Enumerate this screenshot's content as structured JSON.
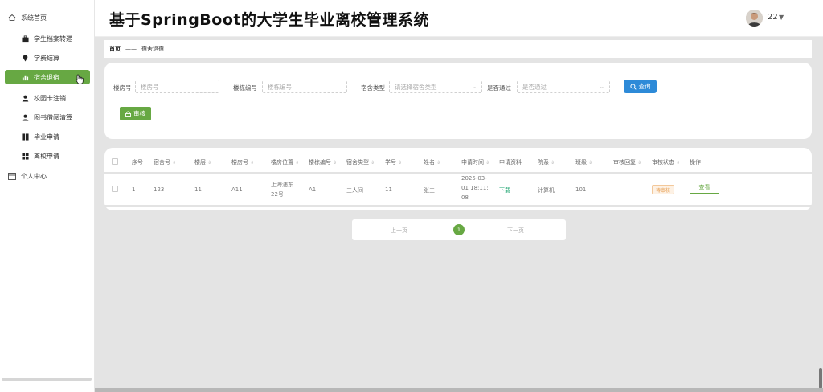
{
  "app": {
    "title": "基于SpringBoot的大学生毕业离校管理系统"
  },
  "user": {
    "name": "22",
    "caret": "▼"
  },
  "sidebar": {
    "home": "系统首页",
    "items": [
      {
        "label": "学生档案转递",
        "icon": "briefcase-icon"
      },
      {
        "label": "学费结算",
        "icon": "pin-icon"
      },
      {
        "label": "宿舍退宿",
        "icon": "bar-chart-icon"
      },
      {
        "label": "校园卡注销",
        "icon": "user-icon"
      },
      {
        "label": "图书借阅清算",
        "icon": "user-icon"
      },
      {
        "label": "毕业申请",
        "icon": "grid-icon"
      },
      {
        "label": "离校申请",
        "icon": "grid-icon"
      }
    ],
    "personal": "个人中心",
    "active_index": 2
  },
  "breadcrumb": {
    "home": "首页",
    "sep": "——",
    "current": "宿舍退宿"
  },
  "filters": {
    "room_label": "楼房号",
    "room_placeholder": "楼房号",
    "building_label": "楼栋编号",
    "building_placeholder": "楼栋编号",
    "type_label": "宿舍类型",
    "type_placeholder": "请选择宿舍类型",
    "pass_label": "是否通过",
    "pass_placeholder": "是否通过",
    "search_button": "查询",
    "audit_button": "审核"
  },
  "table": {
    "columns": [
      "序号",
      "宿舍号",
      "楼层",
      "楼房号",
      "楼房位置",
      "楼栋编号",
      "宿舍类型",
      "学号",
      "姓名",
      "申请时间",
      "申请资料",
      "院系",
      "班级",
      "审核回复",
      "审核状态",
      "操作"
    ],
    "rows": [
      {
        "index": "1",
        "dorm_no": "123",
        "floor": "11",
        "room_no": "A11",
        "location_1": "上海浦东",
        "location_2": "22号",
        "building_no": "A1",
        "dorm_type": "三人间",
        "student_no": "11",
        "name": "张三",
        "time_1": "2025-03-",
        "time_2": "01 18:11:",
        "time_3": "08",
        "material": "下载",
        "department": "计算机",
        "class": "101",
        "reply": "",
        "status": "待审核",
        "action": "查看"
      }
    ]
  },
  "pagination": {
    "prev": "上一页",
    "current": "1",
    "next": "下一页"
  },
  "colors": {
    "accent": "#67a843",
    "primary": "#2d8ad8",
    "pending": "#e59a4a"
  }
}
